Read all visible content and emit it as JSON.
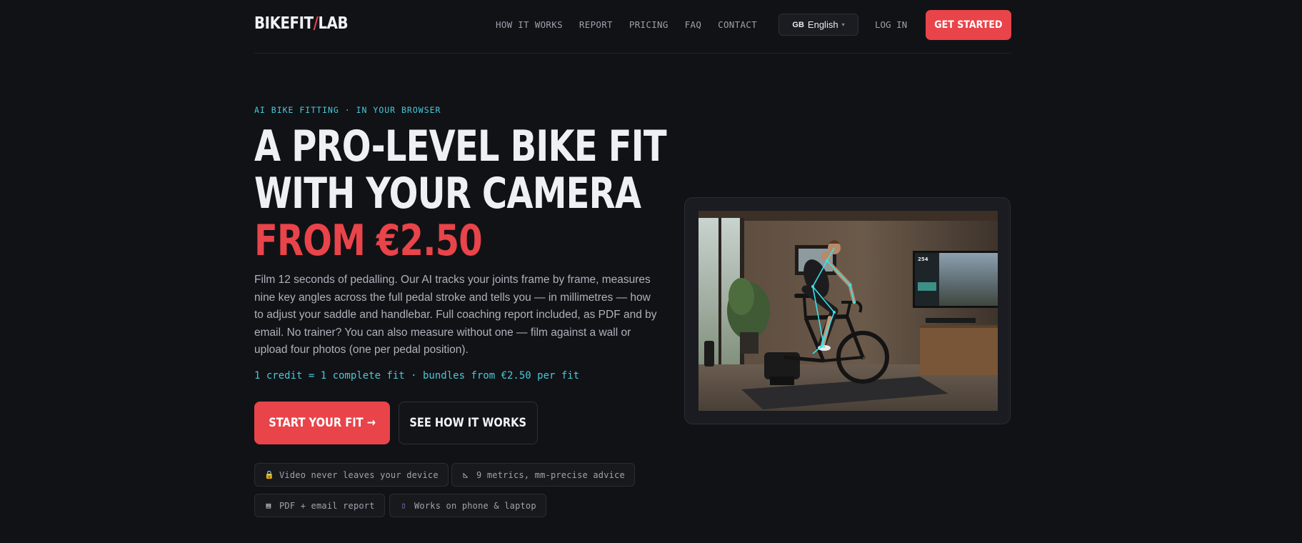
{
  "header": {
    "logo_part1": "BIKEFIT",
    "logo_slash": "/",
    "logo_part2": "LAB",
    "nav": [
      "HOW IT WORKS",
      "REPORT",
      "PRICING",
      "FAQ",
      "CONTACT"
    ],
    "language": {
      "flag": "GB",
      "label": "English"
    },
    "login_label": "LOG IN",
    "cta_label": "GET STARTED"
  },
  "hero": {
    "eyebrow": "AI BIKE FITTING · IN YOUR BROWSER",
    "headline_line1": "A PRO-LEVEL BIKE FIT",
    "headline_line2": "WITH YOUR CAMERA",
    "headline_line3": "FROM €2.50",
    "lead": "Film 12 seconds of pedalling. Our AI tracks your joints frame by frame, measures nine key angles across the full pedal stroke and tells you — in millimetres — how to adjust your saddle and handlebar. Full coaching report included, as PDF and by email. No trainer? You can also measure without one — film against a wall or upload four photos (one per pedal position).",
    "credit_line": "1 credit = 1 complete fit · bundles from €2.50 per fit",
    "primary_button": "START YOUR FIT →",
    "secondary_button": "SEE HOW IT WORKS",
    "chips": [
      {
        "icon": "lock-icon",
        "label": "Video never leaves your device"
      },
      {
        "icon": "ruler-icon",
        "label": "9 metrics, mm-precise advice"
      },
      {
        "icon": "document-icon",
        "label": "PDF + email report"
      },
      {
        "icon": "phone-icon",
        "label": "Works on phone & laptop"
      }
    ]
  },
  "image": {
    "screen_value": "254"
  },
  "colors": {
    "background": "#111216",
    "accent": "#e8444a",
    "highlight": "#46c9d8",
    "text": "#eef0f3",
    "muted": "#aeb2bb"
  }
}
